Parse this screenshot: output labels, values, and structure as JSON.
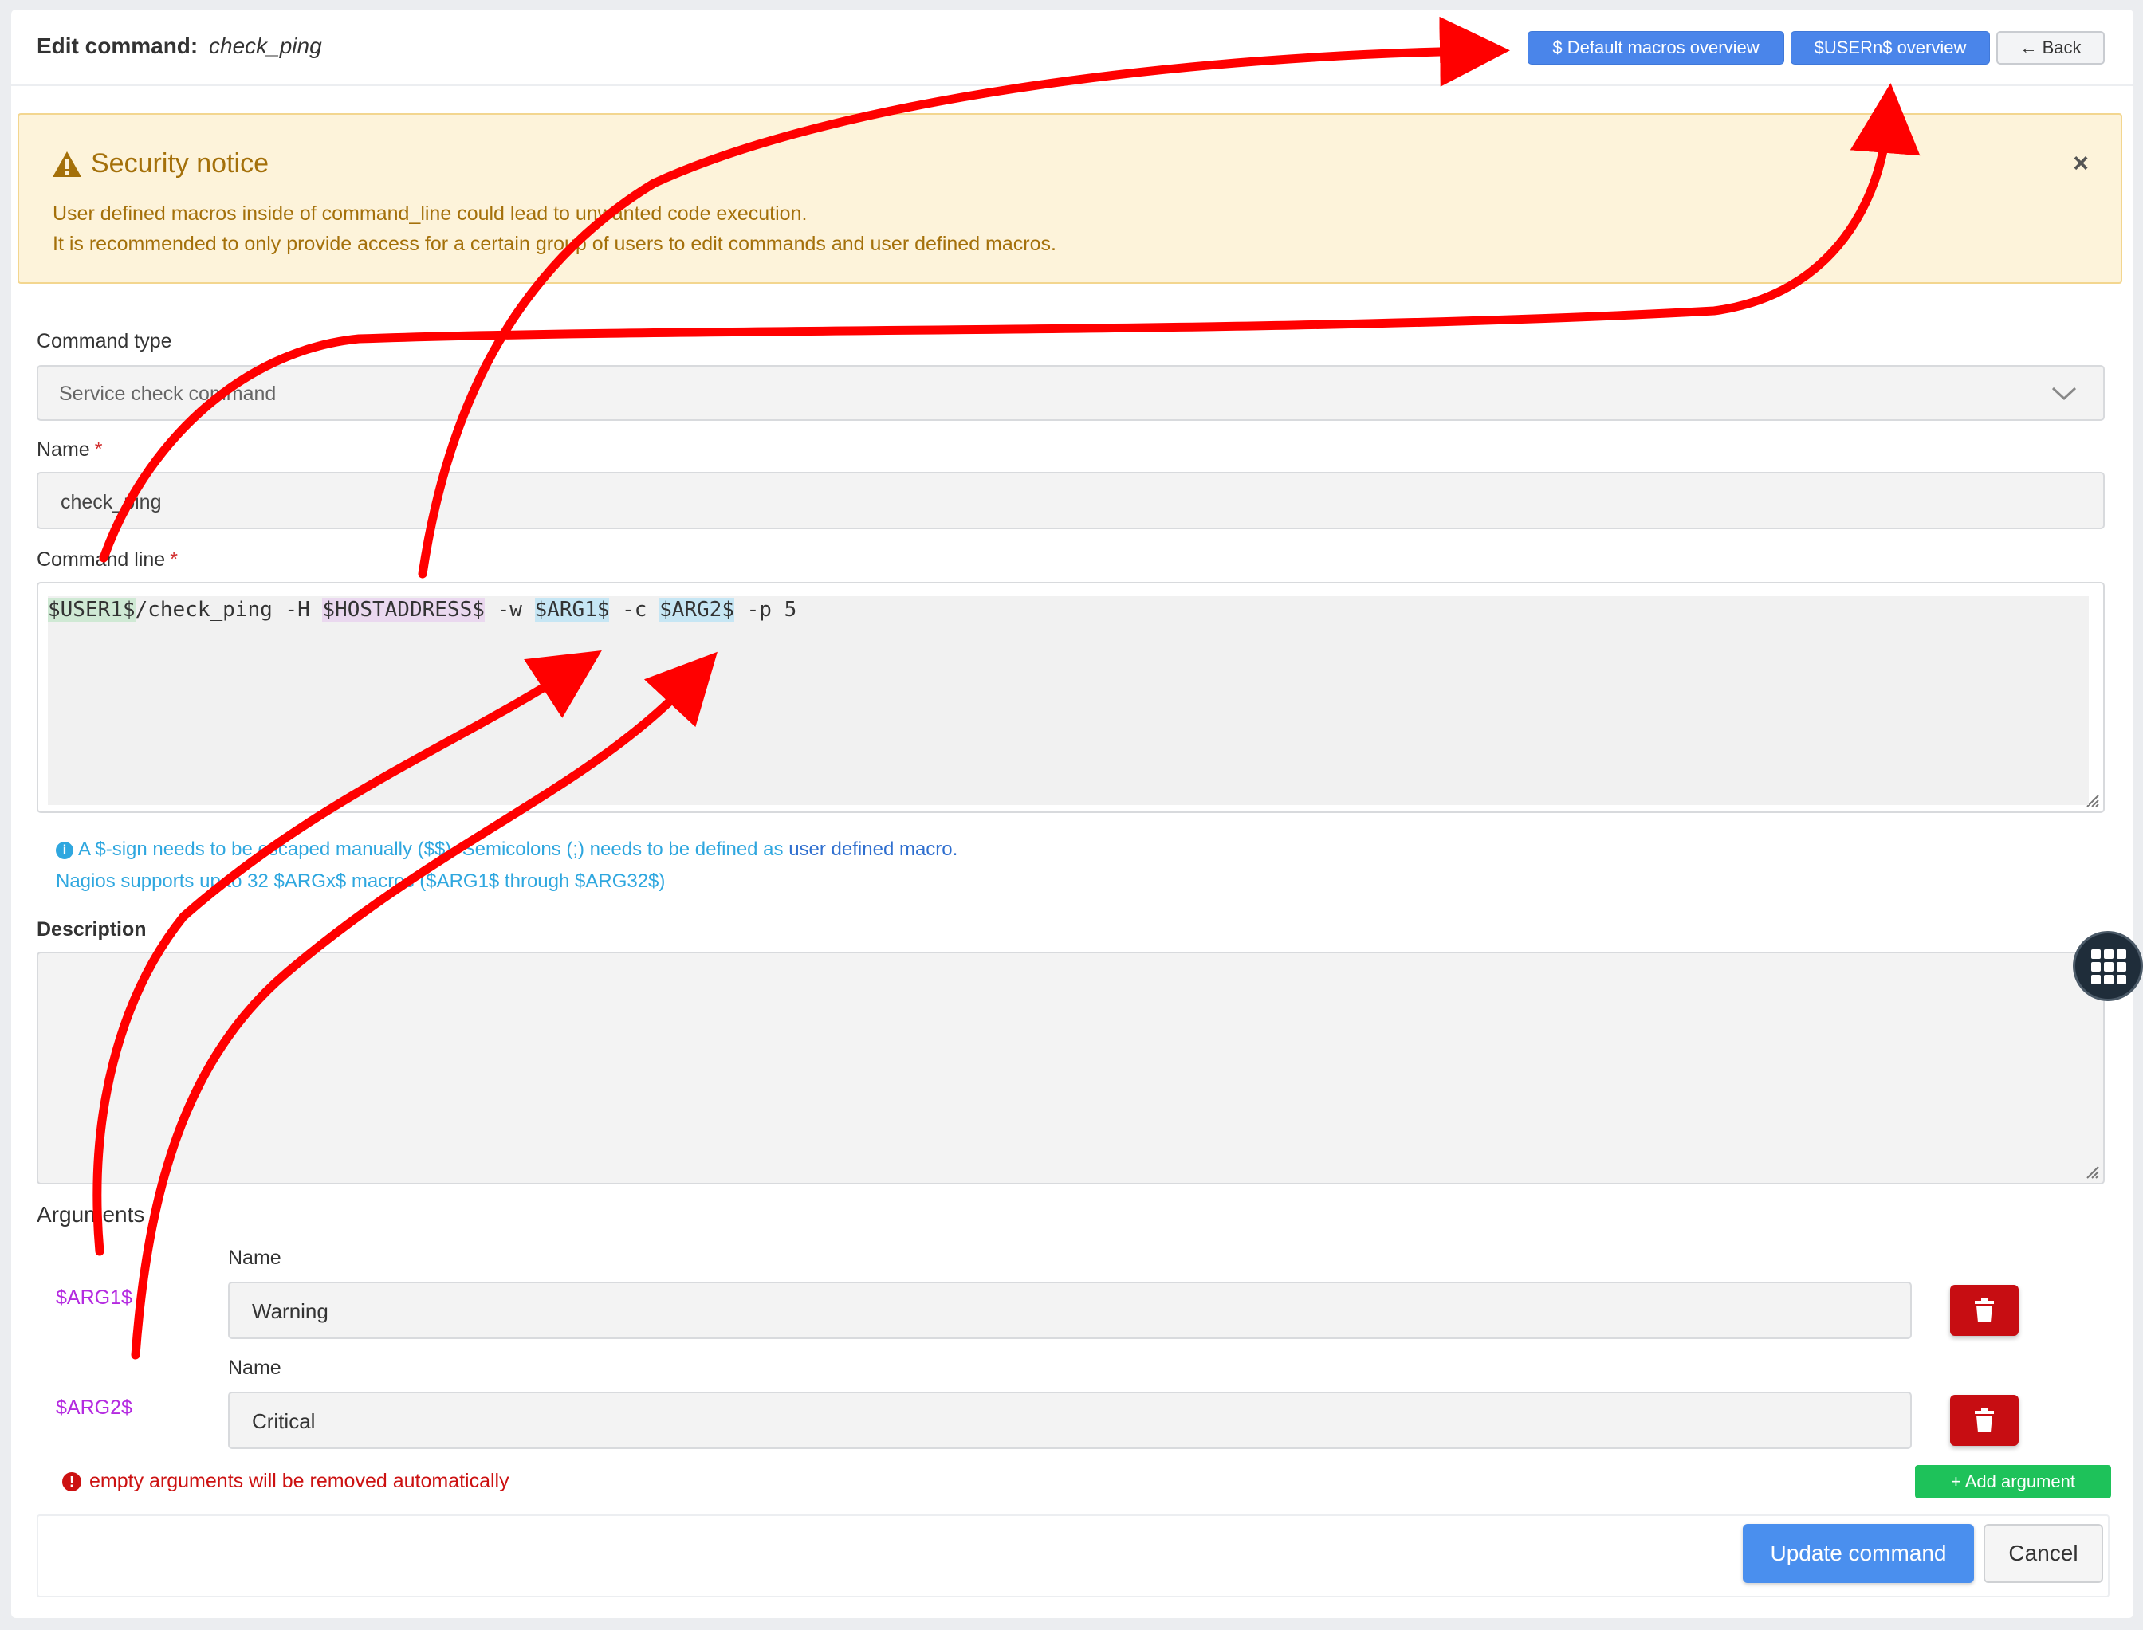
{
  "header": {
    "title_prefix": "Edit command:",
    "title_name": "check_ping",
    "default_macros_btn": "$ Default macros overview",
    "usern_btn": "$USERn$ overview",
    "back_btn": "← Back"
  },
  "notice": {
    "title": "Security notice",
    "line1": "User defined macros inside of command_line could lead to unwanted code execution.",
    "line2": "It is recommended to only provide access for a certain group of users to edit commands and user defined macros.",
    "close": "×"
  },
  "form": {
    "command_type_label": "Command type",
    "command_type_value": "Service check command",
    "name_label": "Name",
    "name_value": "check_ping",
    "required_mark": "*",
    "command_line_label": "Command line",
    "command_line": {
      "user1": "$USER1$",
      "part1": "/check_ping -H ",
      "hostaddress": "$HOSTADDRESS$",
      "part2": " -w ",
      "arg1": "$ARG1$",
      "part3": " -c ",
      "arg2": "$ARG2$",
      "part4": " -p 5"
    },
    "help_line1_a": "A $-sign needs to be escaped manually ($$). Semicolons (;) needs to be defined as ",
    "help_link": "user defined macro.",
    "help_line2": "Nagios supports up to 32 $ARGx$ macros ($ARG1$ through $ARG32$)",
    "description_label": "Description",
    "description_value": ""
  },
  "arguments": {
    "label": "Arguments",
    "name_label": "Name",
    "items": [
      {
        "macro": "$ARG1$",
        "name": "Warning"
      },
      {
        "macro": "$ARG2$",
        "name": "Critical"
      }
    ],
    "warning": "empty arguments will be removed automatically",
    "add_btn": "+ Add argument"
  },
  "footer": {
    "update_btn": "Update command",
    "cancel_btn": "Cancel"
  },
  "colors": {
    "primary": "#4a85ea",
    "danger": "#c70d12",
    "success": "#1ec25a",
    "notice_bg": "#fdf3da",
    "macro": "#b42ae0",
    "annotation_arrow": "#ff0000"
  }
}
